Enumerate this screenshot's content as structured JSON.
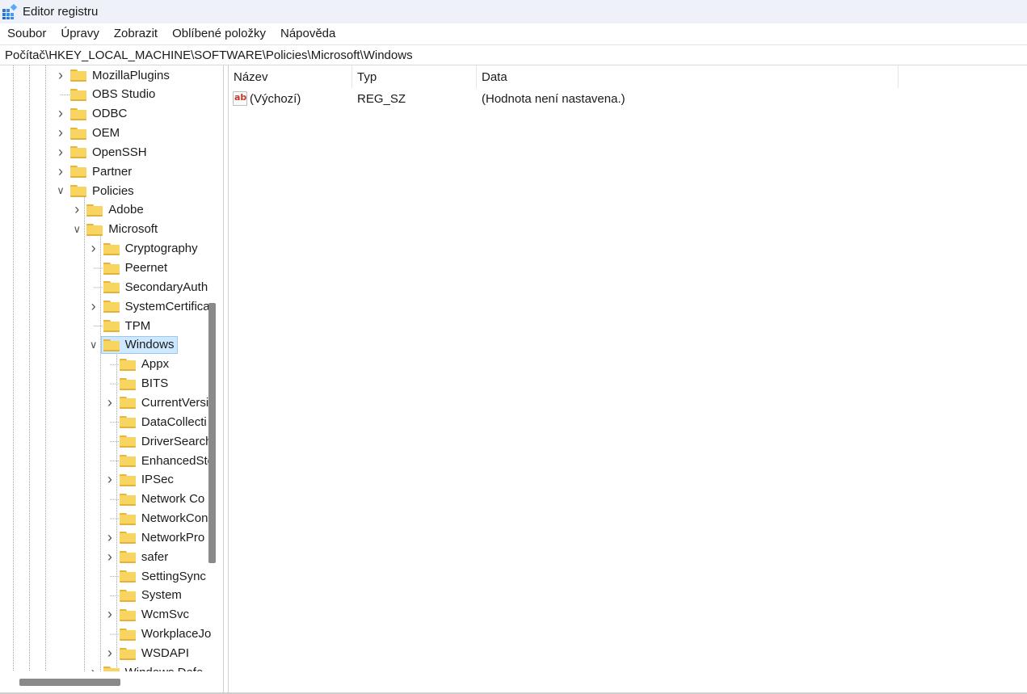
{
  "window": {
    "title": "Editor registru"
  },
  "menu": [
    "Soubor",
    "Úpravy",
    "Zobrazit",
    "Oblíbené položky",
    "Nápověda"
  ],
  "address": "Počítač\\HKEY_LOCAL_MACHINE\\SOFTWARE\\Policies\\Microsoft\\Windows",
  "tree": [
    {
      "label": "MozillaPlugins",
      "level": 0,
      "expander": "collapsed"
    },
    {
      "label": "OBS Studio",
      "level": 0,
      "expander": "none"
    },
    {
      "label": "ODBC",
      "level": 0,
      "expander": "collapsed"
    },
    {
      "label": "OEM",
      "level": 0,
      "expander": "collapsed"
    },
    {
      "label": "OpenSSH",
      "level": 0,
      "expander": "collapsed"
    },
    {
      "label": "Partner",
      "level": 0,
      "expander": "collapsed"
    },
    {
      "label": "Policies",
      "level": 0,
      "expander": "expanded"
    },
    {
      "label": "Adobe",
      "level": 1,
      "expander": "collapsed"
    },
    {
      "label": "Microsoft",
      "level": 1,
      "expander": "expanded"
    },
    {
      "label": "Cryptography",
      "level": 2,
      "expander": "collapsed"
    },
    {
      "label": "Peernet",
      "level": 2,
      "expander": "none"
    },
    {
      "label": "SecondaryAuth",
      "level": 2,
      "expander": "none"
    },
    {
      "label": "SystemCertifica",
      "level": 2,
      "expander": "collapsed"
    },
    {
      "label": "TPM",
      "level": 2,
      "expander": "none"
    },
    {
      "label": "Windows",
      "level": 2,
      "expander": "expanded",
      "selected": true
    },
    {
      "label": "Appx",
      "level": 3,
      "expander": "none"
    },
    {
      "label": "BITS",
      "level": 3,
      "expander": "none"
    },
    {
      "label": "CurrentVersi",
      "level": 3,
      "expander": "collapsed"
    },
    {
      "label": "DataCollecti",
      "level": 3,
      "expander": "none"
    },
    {
      "label": "DriverSearch",
      "level": 3,
      "expander": "none"
    },
    {
      "label": "EnhancedSto",
      "level": 3,
      "expander": "none"
    },
    {
      "label": "IPSec",
      "level": 3,
      "expander": "collapsed"
    },
    {
      "label": "Network Co",
      "level": 3,
      "expander": "none"
    },
    {
      "label": "NetworkCon",
      "level": 3,
      "expander": "none"
    },
    {
      "label": "NetworkPro",
      "level": 3,
      "expander": "collapsed"
    },
    {
      "label": "safer",
      "level": 3,
      "expander": "collapsed"
    },
    {
      "label": "SettingSync",
      "level": 3,
      "expander": "none"
    },
    {
      "label": "System",
      "level": 3,
      "expander": "none"
    },
    {
      "label": "WcmSvc",
      "level": 3,
      "expander": "collapsed"
    },
    {
      "label": "WorkplaceJo",
      "level": 3,
      "expander": "none"
    },
    {
      "label": "WSDAPI",
      "level": 3,
      "expander": "collapsed"
    },
    {
      "label": "Windows Defe",
      "level": 2,
      "expander": "collapsed"
    }
  ],
  "list": {
    "columns": [
      "Název",
      "Typ",
      "Data"
    ],
    "rows": [
      {
        "name": "(Výchozí)",
        "type": "REG_SZ",
        "data": "(Hodnota není nastavena.)",
        "icon": "string-value-icon"
      }
    ]
  }
}
